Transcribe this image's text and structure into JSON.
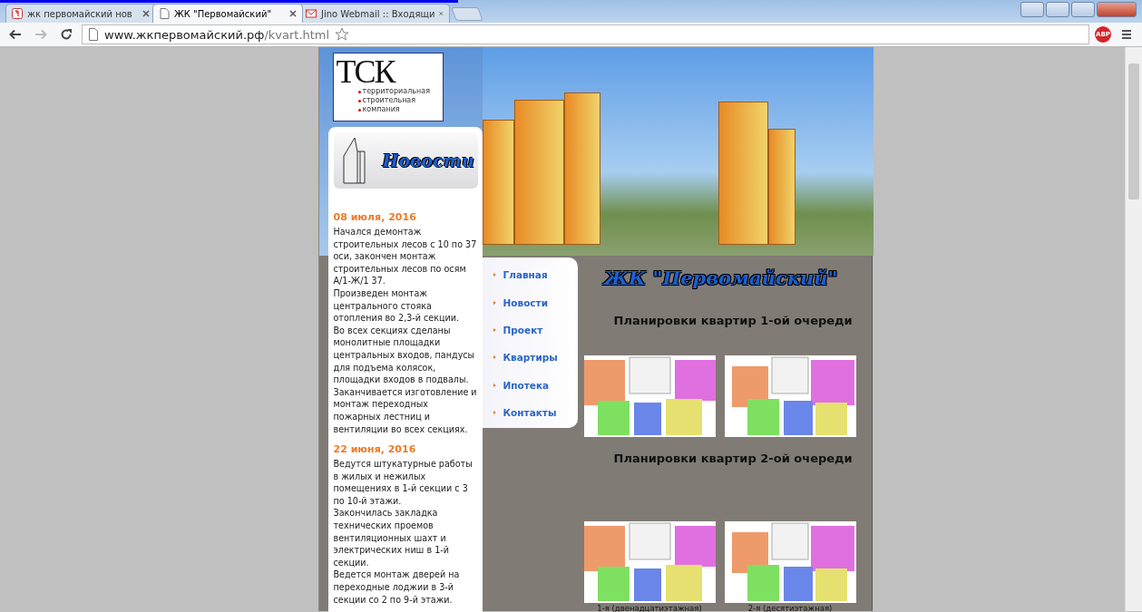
{
  "browser": {
    "tabs": [
      {
        "title": "жк первомайский нов",
        "selected": false
      },
      {
        "title": "ЖК \"Первомайский\"",
        "selected": true
      },
      {
        "title": "Jino Webmail :: Входящи",
        "selected": false
      }
    ],
    "url": {
      "host": "www.жкпервомайский.рф",
      "path": "/kvart.html"
    },
    "extension": "ABP"
  },
  "site": {
    "logo": {
      "letters": "ТСК",
      "lines": [
        "территориальная",
        "строительная",
        "компания"
      ]
    },
    "news_heading": "Новости",
    "news": [
      {
        "date": "08 июля, 2016",
        "paragraphs": [
          "Начался демонтаж строительных лесов с 10 по 37 оси, закончен монтаж строительных лесов по осям А/1-Ж/1  37.",
          "Произведен монтаж центрального стояка отопления во 2,3-й секции.",
          "Во всех секциях сделаны монолитные площадки центральных входов, пандусы для подъема колясок, площадки входов в подвалы.",
          "Заканчивается изготовление и монтаж переходных пожарных лестниц и вентиляции во всех секциях."
        ]
      },
      {
        "date": "22 июня, 2016",
        "paragraphs": [
          "Ведутся штукатурные работы в жилых и нежилых помещениях в 1-й секции с 3 по 10-й этажи.",
          "Закончилась закладка технических проемов вентиляционных шахт и электрических ниш в 1-й секции.",
          "Ведется монтаж дверей на переходные лоджии в 3-й секции со 2 по 9-й этажи."
        ]
      }
    ],
    "nav": [
      "Главная",
      "Новости",
      "Проект",
      "Квартиры",
      "Ипотека",
      "Контакты"
    ],
    "title": "ЖК \"Первомайский\"",
    "sections": [
      {
        "heading": "Планировки квартир 1-ой очереди"
      },
      {
        "heading": "Планировки квартир 2-ой очереди",
        "plans": [
          {
            "caption": "1-я (двенадцатиэтажная)"
          },
          {
            "caption": "2-я (десятиэтажная)"
          }
        ]
      }
    ]
  }
}
